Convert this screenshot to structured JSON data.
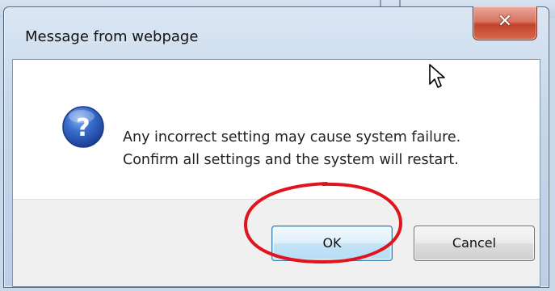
{
  "dialog": {
    "title": "Message from webpage",
    "close_icon": "close-icon",
    "icon": "question-icon",
    "message_lines": [
      "Any incorrect setting may cause system failure.",
      "Confirm all settings and the system will restart."
    ],
    "buttons": {
      "ok_label": "OK",
      "cancel_label": "Cancel"
    }
  },
  "annotation": {
    "shape": "ellipse",
    "color": "#e0141c",
    "target": "ok-button"
  },
  "cursor": "mouse-pointer-icon",
  "colors": {
    "close_button": "#c9472f",
    "ok_border": "#3c7fb1",
    "icon_blue": "#2a5bb8"
  }
}
